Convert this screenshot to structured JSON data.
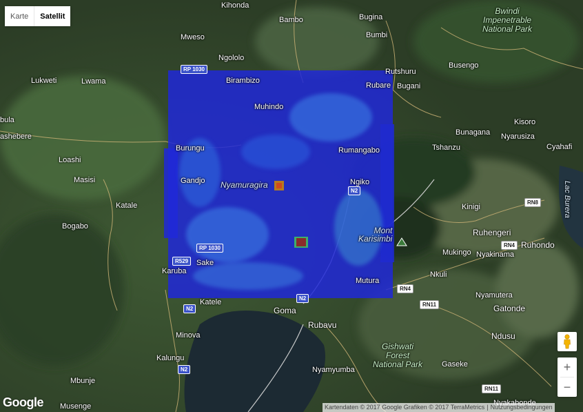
{
  "map_type_control": {
    "options": [
      "Karte",
      "Satellit"
    ],
    "selected": "Satellit"
  },
  "zoom": {
    "in": "+",
    "out": "−"
  },
  "pegman_icon": "pegman-icon",
  "logo": "Google",
  "attribution": {
    "data": "Kartendaten © 2017 Google Grafiken © 2017 TerraMetrics",
    "terms": "Nutzungsbedingungen"
  },
  "places": {
    "kihonda": "Kihonda",
    "bambo": "Bambo",
    "bugina": "Bugina",
    "bumbi": "Bumbi",
    "mweso": "Mweso",
    "ngololo": "Ngololo",
    "rutshuru": "Rutshuru",
    "busengo": "Busengo",
    "birambizo": "Birambizo",
    "rubare": "Rubare",
    "bugani": "Bugani",
    "lukweti": "Lukweti",
    "lwama": "Lwama",
    "muhindo": "Muhindo",
    "kisoro": "Kisoro",
    "bula": "bula",
    "kashebere": "ashebere",
    "bunagana": "Bunagana",
    "nyarusiza": "Nyarusiza",
    "cyahafi": "Cyahafi",
    "tshanzu": "Tshanzu",
    "burungu": "Burungu",
    "rumangabo": "Rumangabo",
    "loashi": "Loashi",
    "masisi": "Masisi",
    "gandjo": "Gandjo",
    "ngiko": "Ngiko",
    "katale": "Katale",
    "kinigi": "Kinigi",
    "bogabo": "Bogabo",
    "ruhengeri": "Ruhengeri",
    "ruhondo": "Ruhondo",
    "mukingo": "Mukingo",
    "nyakinama": "Nyakinama",
    "sake": "Sake",
    "karuba": "Karuba",
    "nkuli": "Nkuli",
    "mutura": "Mutura",
    "nyamutera": "Nyamutera",
    "katele": "Katele",
    "gatonde": "Gatonde",
    "goma": "Goma",
    "rubavu": "Rubavu",
    "minova": "Minova",
    "ndusu": "Ndusu",
    "kalungu": "Kalungu",
    "gaseke": "Gaseke",
    "nyamyumba": "Nyamyumba",
    "mbunje": "Mbunje",
    "musenge": "Musenge",
    "nyakabonde": "Nyakabonde"
  },
  "features": {
    "bwindi": [
      "Bwindi",
      "Impenetrable",
      "National Park"
    ],
    "gishwati": [
      "Gishwati",
      "Forest",
      "National Park"
    ],
    "nyamuragira": "Nyamuragira",
    "mont_karisimbi": [
      "Mont",
      "Karisimbi"
    ],
    "lac_burera": "Lac Burera"
  },
  "road_shields": {
    "rp1030_top": "RP 1030",
    "rp1030_mid": "RP 1030",
    "r529": "R529",
    "n2_ngiko": "N2",
    "n2_goma": "N2",
    "n2_katele": "N2",
    "n2_kalungu": "N2",
    "rn4_east": "RN4",
    "rn4_nkuli": "RN4",
    "rn11_a": "RN11",
    "rn11_b": "RN11",
    "rn8": "RN8"
  },
  "overlay": {
    "hotspots": 2,
    "colors": {
      "low": "#1f2ad8",
      "mid": "#2f7fe0",
      "high": "#9b3b2a"
    }
  }
}
